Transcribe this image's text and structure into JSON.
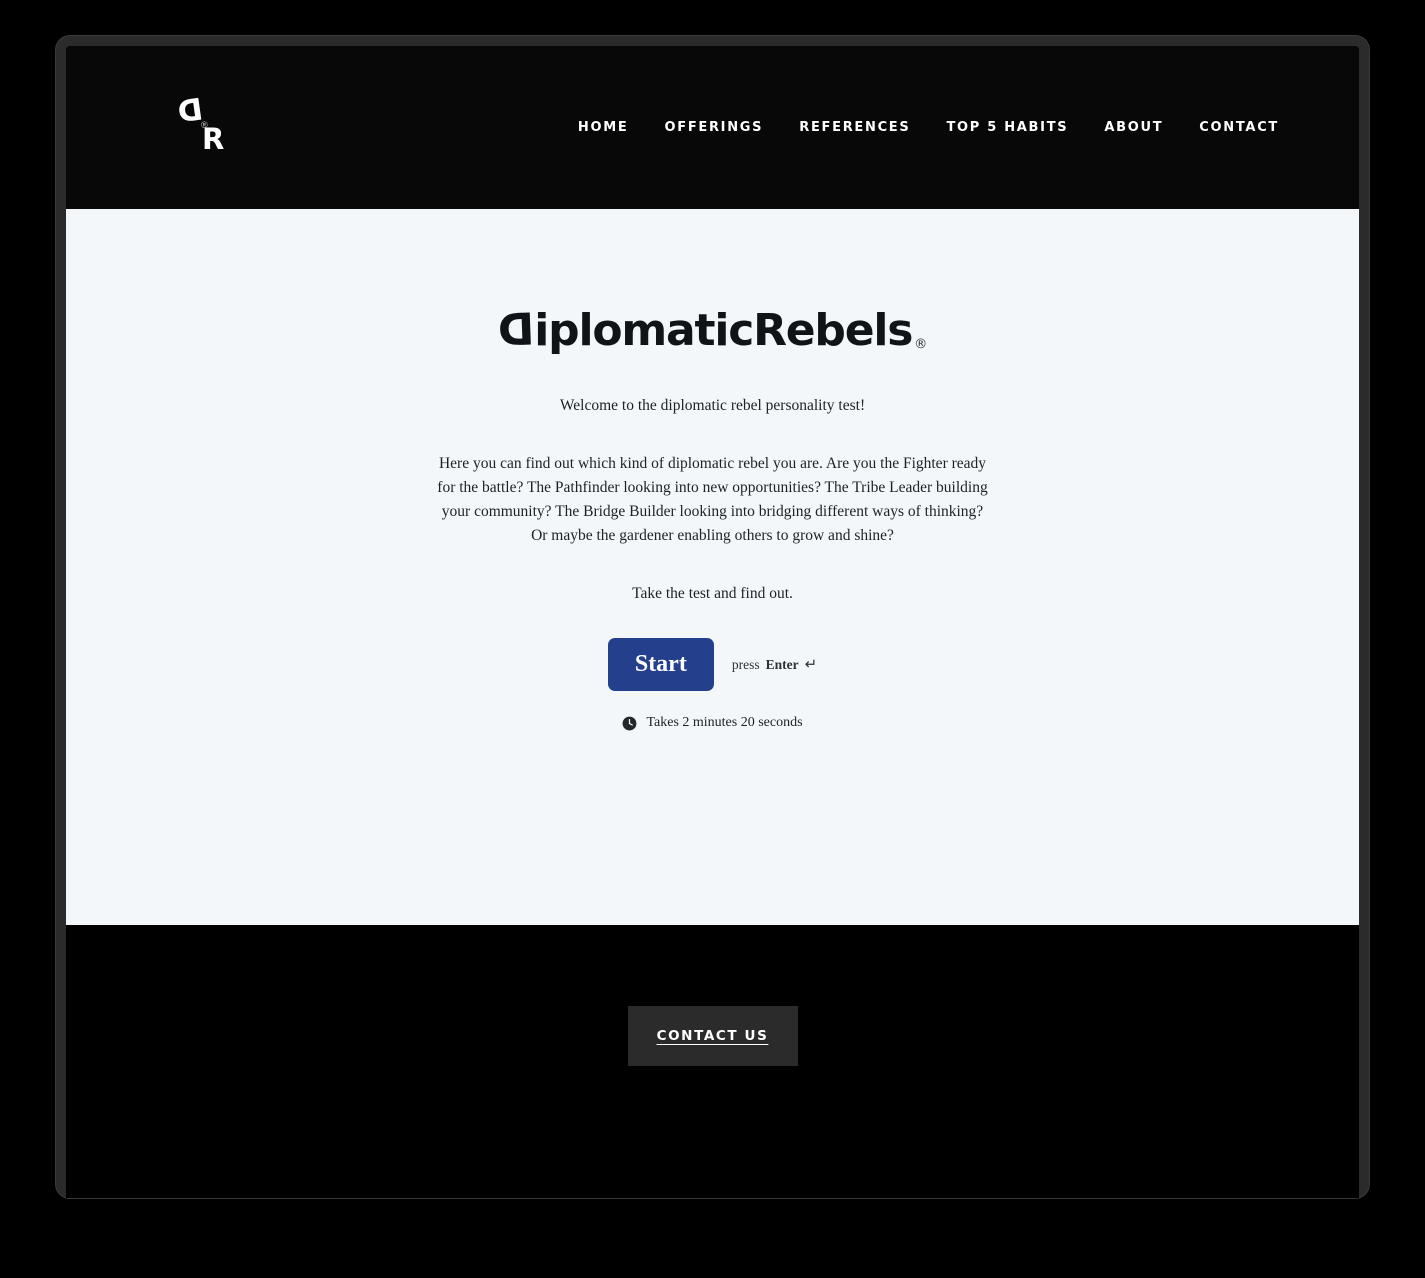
{
  "site": {
    "logo": {
      "name": "diplomaticrebels-logo",
      "letter_d": "D",
      "letter_r": "R",
      "registered_mark": "®"
    },
    "nav": [
      {
        "label": "HOME",
        "name": "nav-link-home"
      },
      {
        "label": "OFFERINGS",
        "name": "nav-link-offerings"
      },
      {
        "label": "REFERENCES",
        "name": "nav-link-references"
      },
      {
        "label": "TOP 5 HABITS",
        "name": "nav-link-top-5-habits"
      },
      {
        "label": "ABOUT",
        "name": "nav-link-about"
      },
      {
        "label": "CONTACT",
        "name": "nav-link-contact"
      }
    ]
  },
  "quiz": {
    "wordmark": {
      "lead_letter": "D",
      "rest": "iplomaticRebels",
      "registered_mark": "®"
    },
    "welcome": "Welcome to the diplomatic rebel personality test!",
    "intro": "Here you can find out which kind of diplomatic rebel you are. Are you the Fighter ready for the battle? The Pathfinder looking into new opportunities? The Tribe Leader building your community? The Bridge Builder looking into bridging different ways of thinking? Or maybe the gardener enabling others to grow and shine?",
    "cta": "Take the test and find out.",
    "start_button_label": "Start",
    "hint_prefix": "press",
    "hint_key": "Enter",
    "hint_arrow": "↵",
    "duration": "Takes 2 minutes 20 seconds"
  },
  "footer": {
    "contact_button_label": "Contact Us"
  },
  "colors": {
    "header_background": "#080808",
    "panel_background": "#f4f7fa",
    "start_button": "#24408d",
    "footer_background": "#000000",
    "contact_button": "#2b2b2b",
    "frame": "#2b2b2b"
  }
}
